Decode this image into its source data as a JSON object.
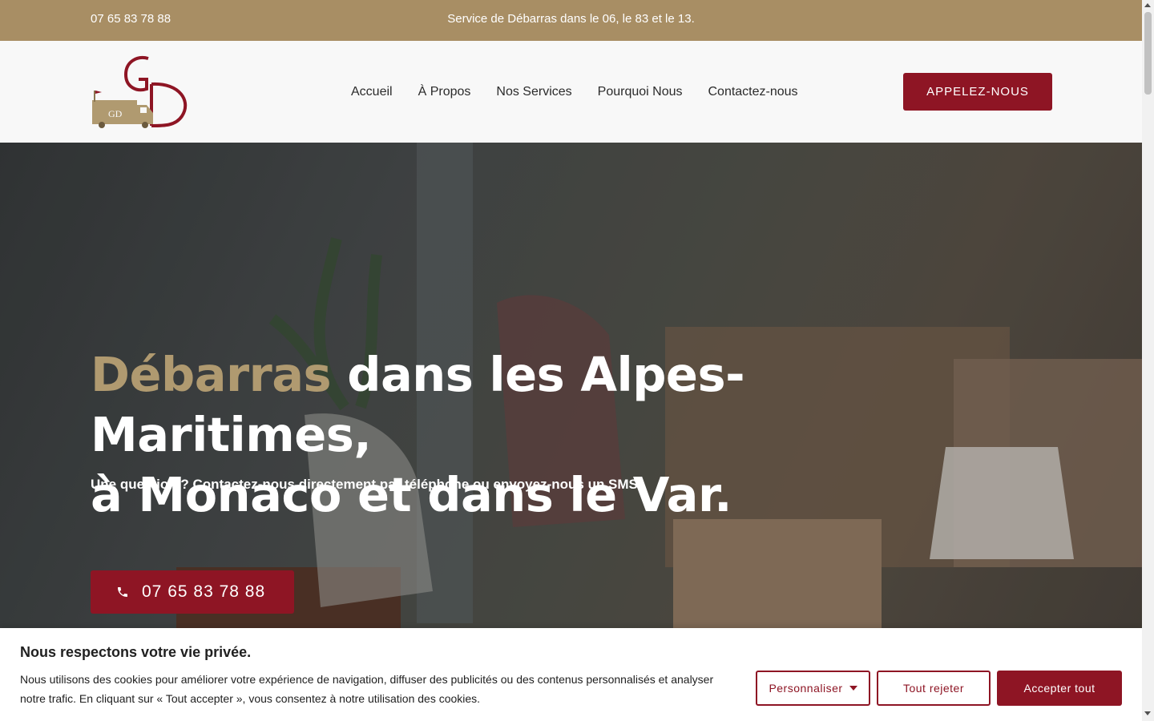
{
  "topbar": {
    "phone": "07 65 83 78 88",
    "tagline": "Service de Débarras dans le 06, le 83 et le 13."
  },
  "header": {
    "logo_icon": "gd-truck-logo",
    "nav": [
      "Accueil",
      "À Propos",
      "Nos Services",
      "Pourquoi Nous",
      "Contactez-nous"
    ],
    "cta_label": "APPELEZ-NOUS"
  },
  "hero": {
    "title_accent": "Débarras",
    "title_rest_line1": " dans les Alpes-Maritimes,",
    "title_line2": "à Monaco et dans le Var.",
    "subtitle": "Une question ? Contactez-nous directement par téléphone ou envoyez-nous un SMS.",
    "call_button": "07 65 83 78 88",
    "call_icon": "phone-icon"
  },
  "cookie_banner": {
    "title": "Nous respectons votre vie privée.",
    "text": "Nous utilisons des cookies pour améliorer votre expérience de navigation, diffuser des publicités ou des contenus personnalisés et analyser notre trafic. En cliquant sur « Tout accepter », vous consentez à notre utilisation des cookies.",
    "customize": "Personnaliser",
    "reject": "Tout rejeter",
    "accept": "Accepter tout"
  },
  "colors": {
    "gold": "#a88e64",
    "burgundy": "#8e1524",
    "accent_text": "#b09a70"
  }
}
